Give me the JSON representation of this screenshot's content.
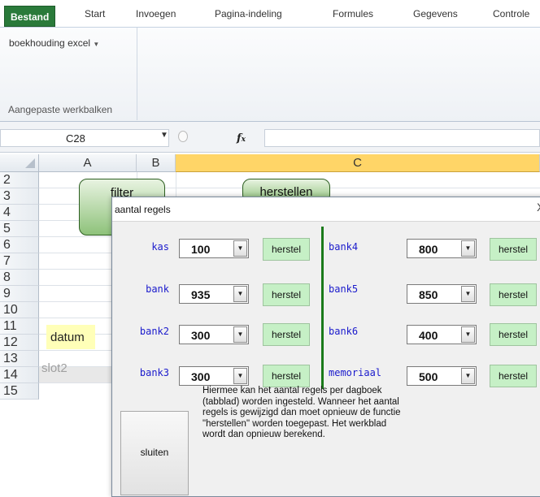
{
  "ribbon": {
    "tabs": [
      "Bestand",
      "Start",
      "Invoegen",
      "Pagina-indeling",
      "Formules",
      "Gegevens",
      "Controle"
    ],
    "workbook_button": "boekhouding excel",
    "group_label": "Aangepaste werkbalken"
  },
  "formula_bar": {
    "name_box": "C28",
    "fx": "fx",
    "formula": ""
  },
  "grid": {
    "columns": [
      "A",
      "B",
      "C"
    ],
    "rows": [
      "2",
      "3",
      "4",
      "5",
      "6",
      "7",
      "8",
      "9",
      "10",
      "11",
      "12",
      "13",
      "14",
      "15"
    ],
    "filter_button": "filter",
    "herstellen_button": "herstellen",
    "datum": "datum",
    "slot2": "slot2"
  },
  "dialog": {
    "title": "aantal regels",
    "close": "X",
    "left": [
      {
        "label": "kas",
        "value": "100",
        "button": "herstel"
      },
      {
        "label": "bank",
        "value": "935",
        "button": "herstel"
      },
      {
        "label": "bank2",
        "value": "300",
        "button": "herstel"
      },
      {
        "label": "bank3",
        "value": "300",
        "button": "herstel"
      }
    ],
    "right": [
      {
        "label": "bank4",
        "value": "800",
        "button": "herstel"
      },
      {
        "label": "bank5",
        "value": "850",
        "button": "herstel"
      },
      {
        "label": "bank6",
        "value": "400",
        "button": "herstel"
      },
      {
        "label": "memoriaal",
        "value": "500",
        "button": "herstel"
      }
    ],
    "close_button": "sluiten",
    "info_lines": [
      "Hiermee kan het aantal regels per dagboek",
      "(tabblad) worden ingesteld. Wanneer het aantal",
      "regels is gewijzigd dan moet opnieuw de functie",
      "\"herstellen\" worden toegepast. Het werkblad",
      "wordt dan opnieuw berekend."
    ]
  }
}
